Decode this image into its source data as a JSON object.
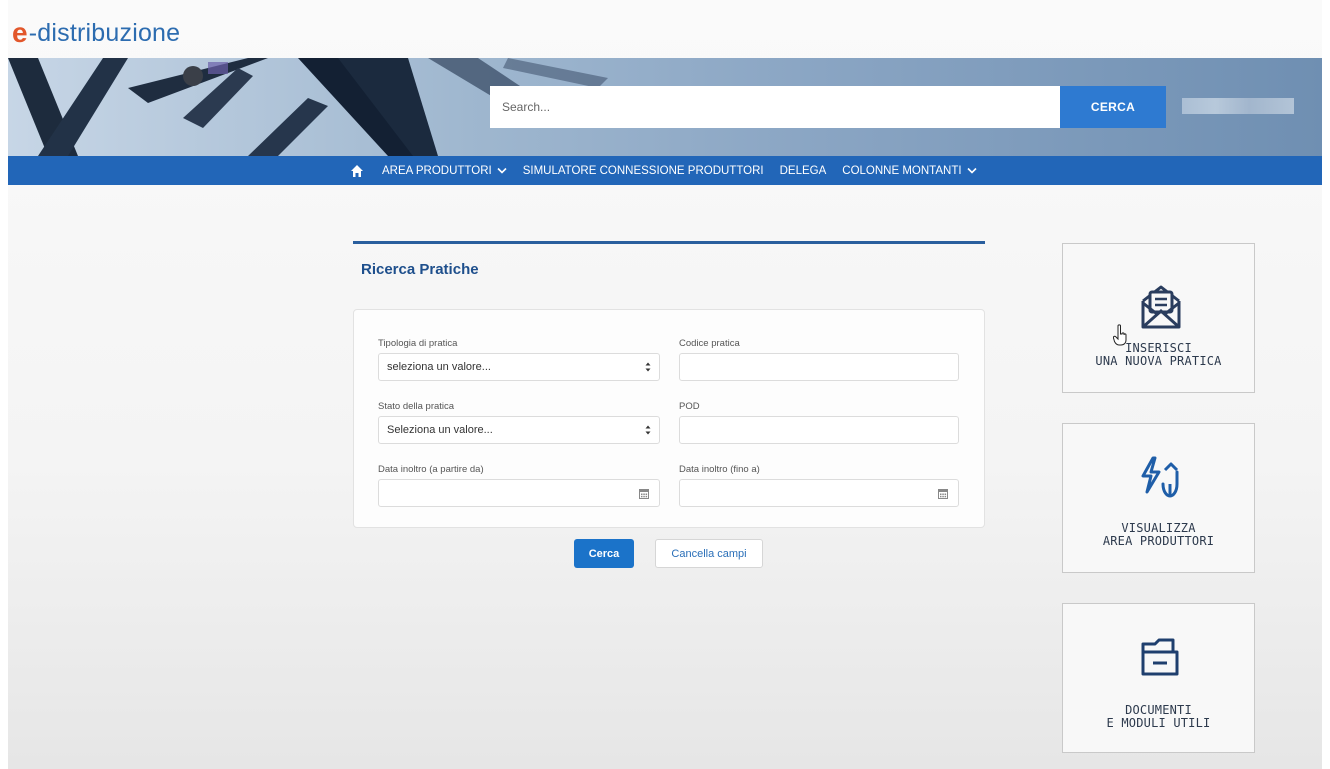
{
  "header": {
    "logo_mark": "e",
    "logo_text": "-distribuzione"
  },
  "search": {
    "placeholder": "Search...",
    "button_label": "CERCA"
  },
  "nav": {
    "items": [
      {
        "label": "AREA PRODUTTORI",
        "has_dropdown": true
      },
      {
        "label": "SIMULATORE CONNESSIONE PRODUTTORI",
        "has_dropdown": false
      },
      {
        "label": "DELEGA",
        "has_dropdown": false
      },
      {
        "label": "COLONNE MONTANTI",
        "has_dropdown": true
      }
    ]
  },
  "form": {
    "title": "Ricerca Pratiche",
    "fields": {
      "tipologia_label": "Tipologia di pratica",
      "tipologia_value": "seleziona un valore...",
      "codice_label": "Codice pratica",
      "codice_value": "",
      "stato_label": "Stato della pratica",
      "stato_value": "Seleziona un valore...",
      "pod_label": "POD",
      "pod_value": "",
      "data_da_label": "Data inoltro (a partire da)",
      "data_da_value": "",
      "data_a_label": "Data inoltro (fino a)",
      "data_a_value": ""
    },
    "submit_label": "Cerca",
    "reset_label": "Cancella campi"
  },
  "cards": [
    {
      "line1": "INSERISCI",
      "line2": "UNA NUOVA PRATICA",
      "icon": "envelope-document-icon"
    },
    {
      "line1": "VISUALIZZA",
      "line2": "AREA PRODUTTORI",
      "icon": "energy-plug-icon"
    },
    {
      "line1": "DOCUMENTI",
      "line2": "E MODULI UTILI",
      "icon": "folder-icon"
    }
  ],
  "colors": {
    "brand_blue": "#2266b8",
    "logo_orange": "#e2572b",
    "button_blue": "#1b73c9",
    "title_blue": "#1e4f8c"
  }
}
